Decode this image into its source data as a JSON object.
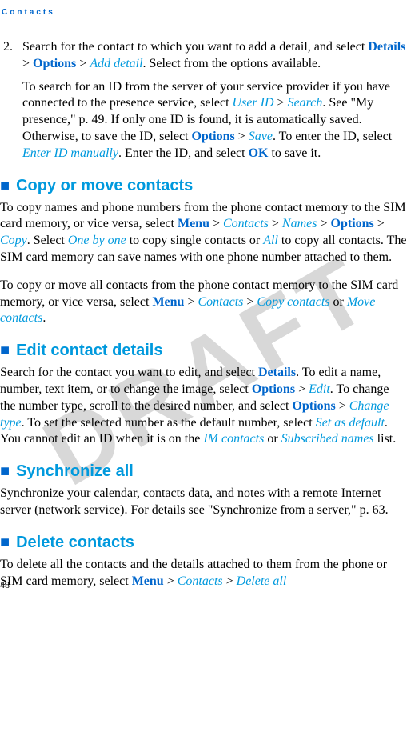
{
  "header": "Contacts",
  "page_number": "48",
  "watermark": "DRAFT",
  "step2_num": "2.",
  "step2_a": "Search for the contact to which you want to add a detail, and select ",
  "step2_details": "Details",
  "step2_gt1": " > ",
  "step2_options": "Options",
  "step2_gt2": " > ",
  "step2_add_detail": "Add detail",
  "step2_b": ". Select from the options available.",
  "step2_para2_a": "To search for an ID from the server of your service provider if you have connected to the presence service, select ",
  "step2_userid": "User ID",
  "step2_para2_gt1": " > ",
  "step2_search": "Search",
  "step2_para2_b": ". See \"My presence,\" p. 49. If only one ID is found, it is automatically saved. Otherwise, to save the ID, select ",
  "step2_options2": "Options",
  "step2_para2_gt2": " > ",
  "step2_save": "Save",
  "step2_para2_c": ". To enter the ID, select ",
  "step2_enterid": "Enter ID manually",
  "step2_para2_d": ". Enter the ID, and select ",
  "step2_ok": "OK",
  "step2_para2_e": " to save it.",
  "sec1_marker": "■",
  "sec1_title": "Copy or move contacts",
  "sec1_p1_a": "To copy names and phone numbers from the phone contact memory to the SIM card memory, or vice versa, select ",
  "sec1_menu": "Menu",
  "sec1_gt1": " > ",
  "sec1_contacts": "Contacts",
  "sec1_gt2": " > ",
  "sec1_names": "Names",
  "sec1_gt3": " > ",
  "sec1_options": "Options",
  "sec1_gt4": " > ",
  "sec1_copy": "Copy",
  "sec1_p1_b": ". Select ",
  "sec1_onebyone": "One by one",
  "sec1_p1_c": " to copy single contacts or ",
  "sec1_all": "All",
  "sec1_p1_d": " to copy all contacts. The SIM card memory can save names with one phone number attached to them.",
  "sec1_p2_a": "To copy or move all contacts from the phone contact memory to the SIM card memory, or vice versa, select ",
  "sec1_p2_menu": "Menu",
  "sec1_p2_gt1": " > ",
  "sec1_p2_contacts": "Contacts",
  "sec1_p2_gt2": " > ",
  "sec1_p2_copycontacts": "Copy contacts",
  "sec1_p2_or": " or ",
  "sec1_p2_movecontacts": "Move contacts",
  "sec1_p2_end": ".",
  "sec2_marker": "■",
  "sec2_title": "Edit contact details",
  "sec2_p1_a": "Search for the contact you want to edit, and select ",
  "sec2_details": "Details",
  "sec2_p1_b": ". To edit a name, number, text item, or to change the image, select ",
  "sec2_options": "Options",
  "sec2_gt1": " > ",
  "sec2_edit": "Edit",
  "sec2_p1_c": ". To change the number type, scroll to the desired number, and select ",
  "sec2_options2": "Options",
  "sec2_gt2": " > ",
  "sec2_changetype": "Change type",
  "sec2_p1_d": ". To set the selected number as the default number, select ",
  "sec2_setdefault": "Set as default",
  "sec2_p1_e": ". You cannot edit an ID when it is on the ",
  "sec2_imcontacts": "IM contacts",
  "sec2_p1_f": " or ",
  "sec2_subscribed": "Subscribed names",
  "sec2_p1_g": " list.",
  "sec3_marker": "■",
  "sec3_title": "Synchronize all",
  "sec3_p1": "Synchronize your calendar, contacts data, and notes with a remote Internet server (network service). For details see \"Synchronize from a server,\" p. 63.",
  "sec4_marker": "■",
  "sec4_title": "Delete contacts",
  "sec4_p1_a": "To delete all the contacts and the details attached to them from the phone or SIM card memory, select ",
  "sec4_menu": "Menu",
  "sec4_gt1": " > ",
  "sec4_contacts": "Contacts",
  "sec4_gt2": " > ",
  "sec4_deleteall": "Delete all"
}
